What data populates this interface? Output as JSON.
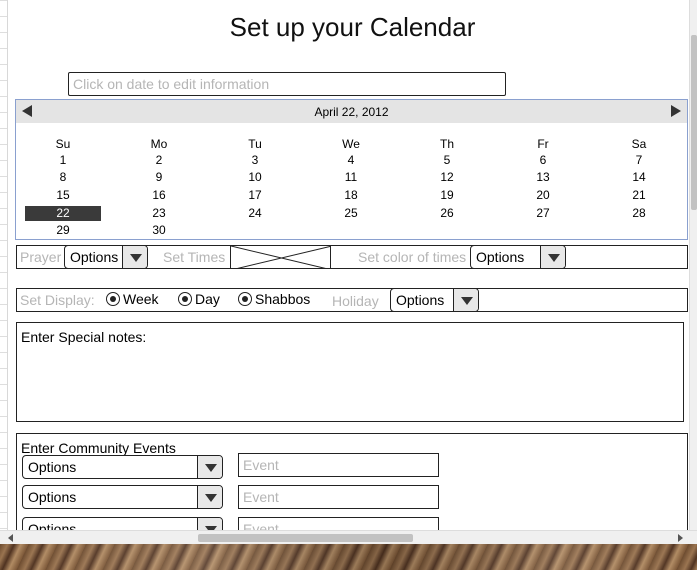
{
  "page": {
    "title": "Set up your Calendar",
    "edit_placeholder": "Click on date to edit information"
  },
  "calendar": {
    "month_label": "April 22, 2012",
    "weekdays": [
      "Su",
      "Mo",
      "Tu",
      "We",
      "Th",
      "Fr",
      "Sa"
    ],
    "weeks": [
      [
        "1",
        "2",
        "3",
        "4",
        "5",
        "6",
        "7"
      ],
      [
        "8",
        "9",
        "10",
        "11",
        "12",
        "13",
        "14"
      ],
      [
        "15",
        "16",
        "17",
        "18",
        "19",
        "20",
        "21"
      ],
      [
        "22",
        "23",
        "24",
        "25",
        "26",
        "27",
        "28"
      ],
      [
        "29",
        "30",
        "",
        "",
        "",
        "",
        ""
      ]
    ],
    "selected_day": "22",
    "accent_color": "#3a3a3a"
  },
  "prayer_row": {
    "prayer_label": "Prayer",
    "prayer_dropdown": "Options",
    "set_times_label": "Set  Times",
    "color_label": "Set color of times",
    "color_dropdown": "Options"
  },
  "display_row": {
    "set_display_label": "Set Display:",
    "radios": [
      "Week",
      "Day",
      "Shabbos"
    ],
    "holiday_label": "Holiday",
    "holiday_dropdown": "Options"
  },
  "notes": {
    "label": "Enter Special notes:"
  },
  "community_events": {
    "label": "Enter Community Events",
    "rows": [
      {
        "dropdown": "Options",
        "event_placeholder": "Event"
      },
      {
        "dropdown": "Options",
        "event_placeholder": "Event"
      },
      {
        "dropdown": "Options",
        "event_placeholder": "Event"
      }
    ]
  }
}
